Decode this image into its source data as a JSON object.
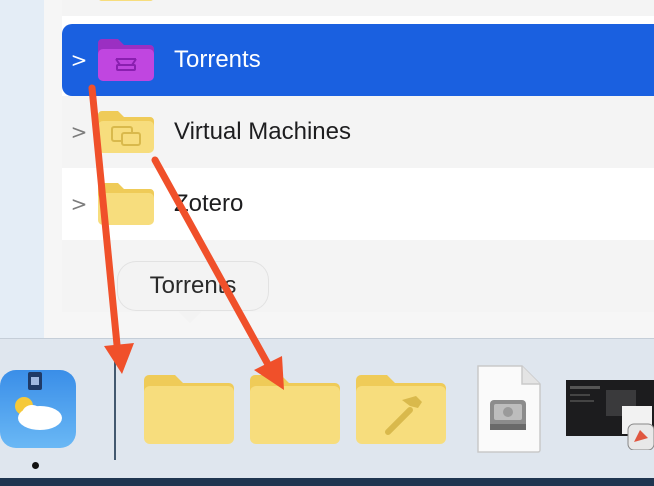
{
  "finder": {
    "rows": [
      {
        "label": "Torrents",
        "selected": true,
        "folder_color": "purple"
      },
      {
        "label": "Virtual Machines",
        "selected": false,
        "folder_color": "yellow"
      },
      {
        "label": "Zotero",
        "selected": false,
        "folder_color": "yellow"
      }
    ],
    "expand_glyph": ">"
  },
  "tooltip": {
    "text": "Torrents"
  },
  "dock": {
    "items": [
      "weather-app-icon",
      "folder-icon",
      "folder-icon",
      "developer-folder-icon",
      "disk-image-file-icon",
      "screenshot-thumbnail"
    ]
  },
  "colors": {
    "selection": "#1a60e0",
    "annotation_arrow": "#f0502a",
    "folder_yellow": "#f7d96b",
    "folder_purple": "#b640d8"
  }
}
